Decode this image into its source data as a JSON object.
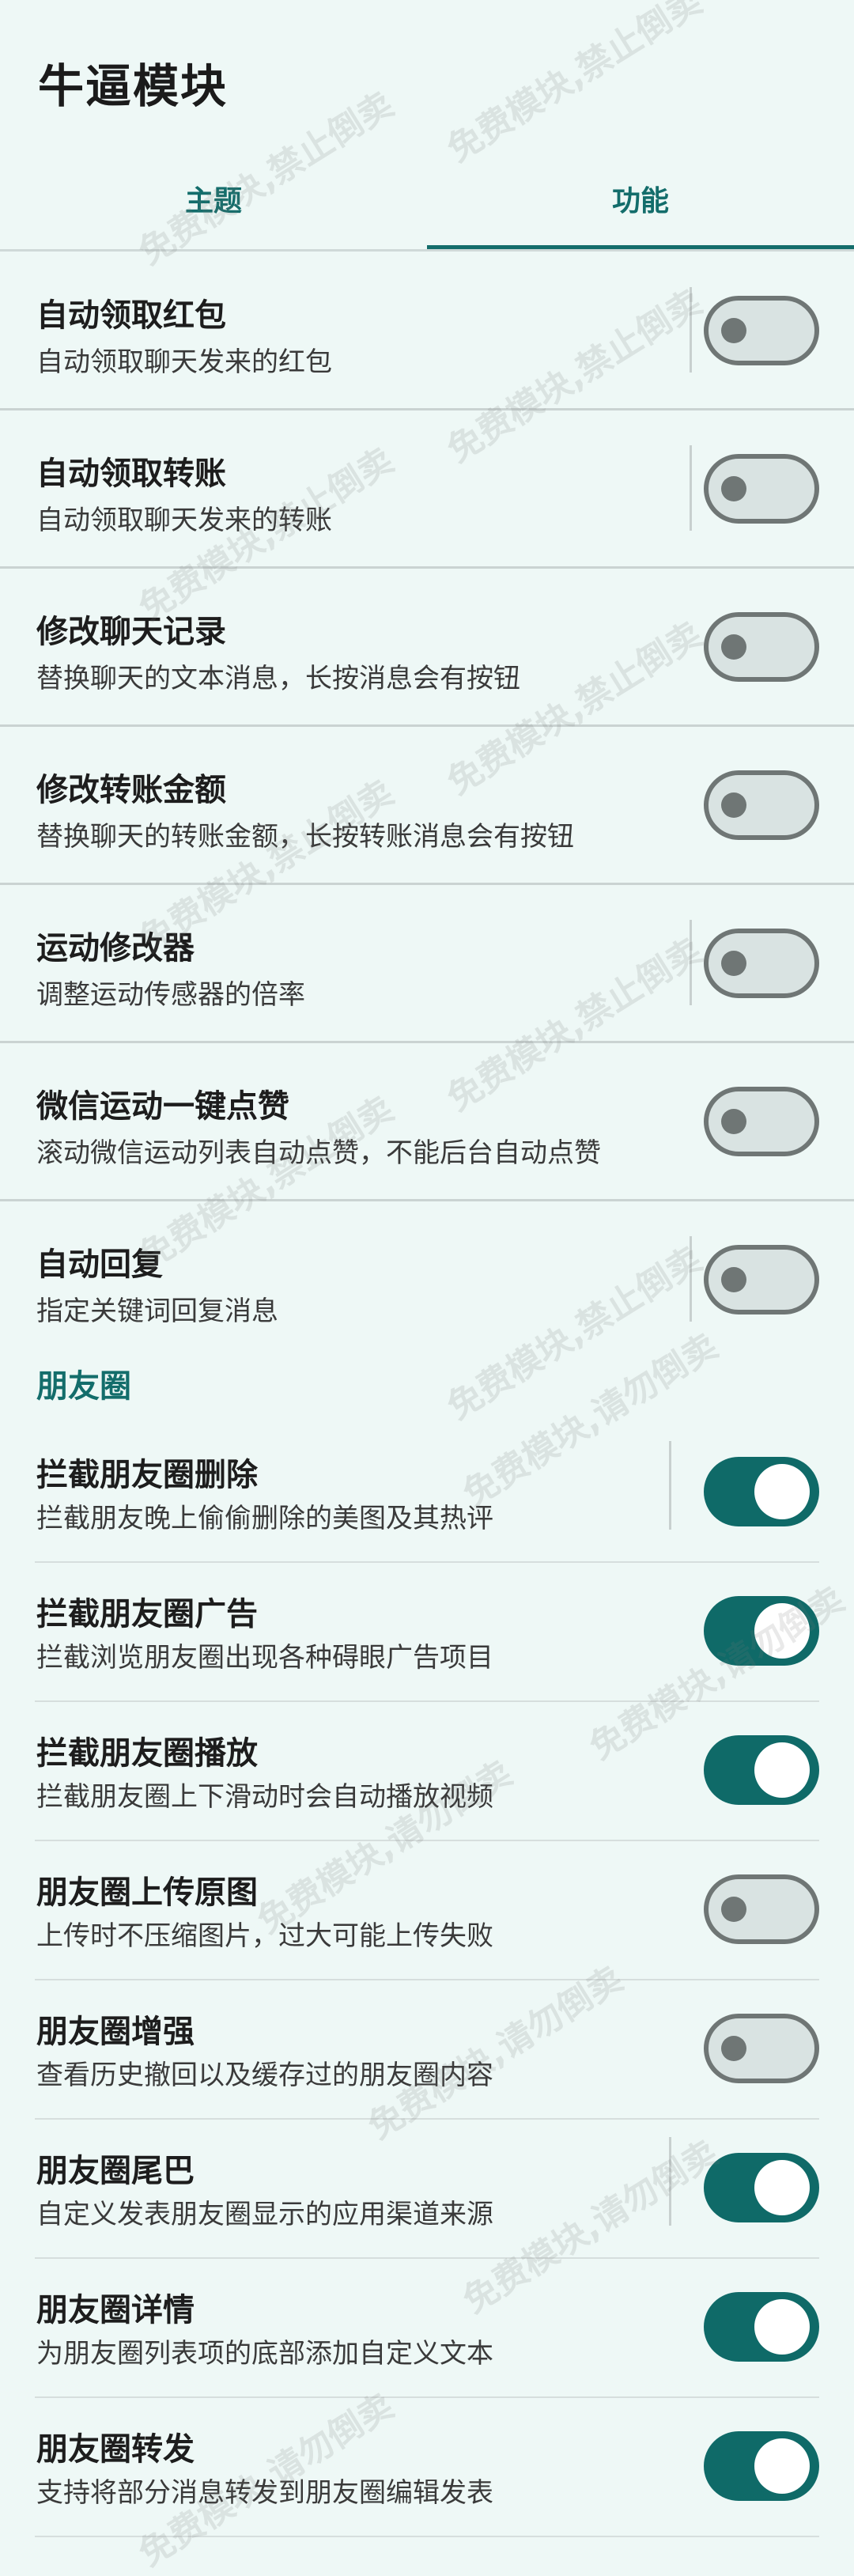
{
  "app": {
    "title": "牛逼模块"
  },
  "tabs": [
    {
      "label": "主题"
    },
    {
      "label": "功能"
    }
  ],
  "features": [
    {
      "title": "自动领取红包",
      "subtitle": "自动领取聊天发来的红包",
      "enabled": false
    },
    {
      "title": "自动领取转账",
      "subtitle": "自动领取聊天发来的转账",
      "enabled": false
    },
    {
      "title": "修改聊天记录",
      "subtitle": "替换聊天的文本消息，长按消息会有按钮",
      "enabled": false
    },
    {
      "title": "修改转账金额",
      "subtitle": "替换聊天的转账金额，长按转账消息会有按钮",
      "enabled": false
    },
    {
      "title": "运动修改器",
      "subtitle": "调整运动传感器的倍率",
      "enabled": false
    },
    {
      "title": "微信运动一键点赞",
      "subtitle": "滚动微信运动列表自动点赞，不能后台自动点赞",
      "enabled": false
    },
    {
      "title": "自动回复",
      "subtitle": "指定关键词回复消息",
      "enabled": false
    }
  ],
  "moments_section": {
    "header": "朋友圈",
    "items": [
      {
        "title": "拦截朋友圈删除",
        "subtitle": "拦截朋友晚上偷偷删除的美图及其热评",
        "enabled": true
      },
      {
        "title": "拦截朋友圈广告",
        "subtitle": "拦截浏览朋友圈出现各种碍眼广告项目",
        "enabled": true
      },
      {
        "title": "拦截朋友圈播放",
        "subtitle": "拦截朋友圈上下滑动时会自动播放视频",
        "enabled": true
      },
      {
        "title": "朋友圈上传原图",
        "subtitle": "上传时不压缩图片，过大可能上传失败",
        "enabled": false
      },
      {
        "title": "朋友圈增强",
        "subtitle": "查看历史撤回以及缓存过的朋友圈内容",
        "enabled": false
      },
      {
        "title": "朋友圈尾巴",
        "subtitle": "自定义发表朋友圈显示的应用渠道来源",
        "enabled": true
      },
      {
        "title": "朋友圈详情",
        "subtitle": "为朋友圈列表项的底部添加自定义文本",
        "enabled": true
      },
      {
        "title": "朋友圈转发",
        "subtitle": "支持将部分消息转发到朋友圈编辑发表",
        "enabled": true
      }
    ]
  },
  "watermarks": {
    "top": "免费模块,禁止倒卖",
    "bottom": "免费模块,请勿倒卖"
  },
  "colors": {
    "accent": "#136d6b",
    "toggle_on": "#0f6a68",
    "background": "#eef8f6"
  }
}
